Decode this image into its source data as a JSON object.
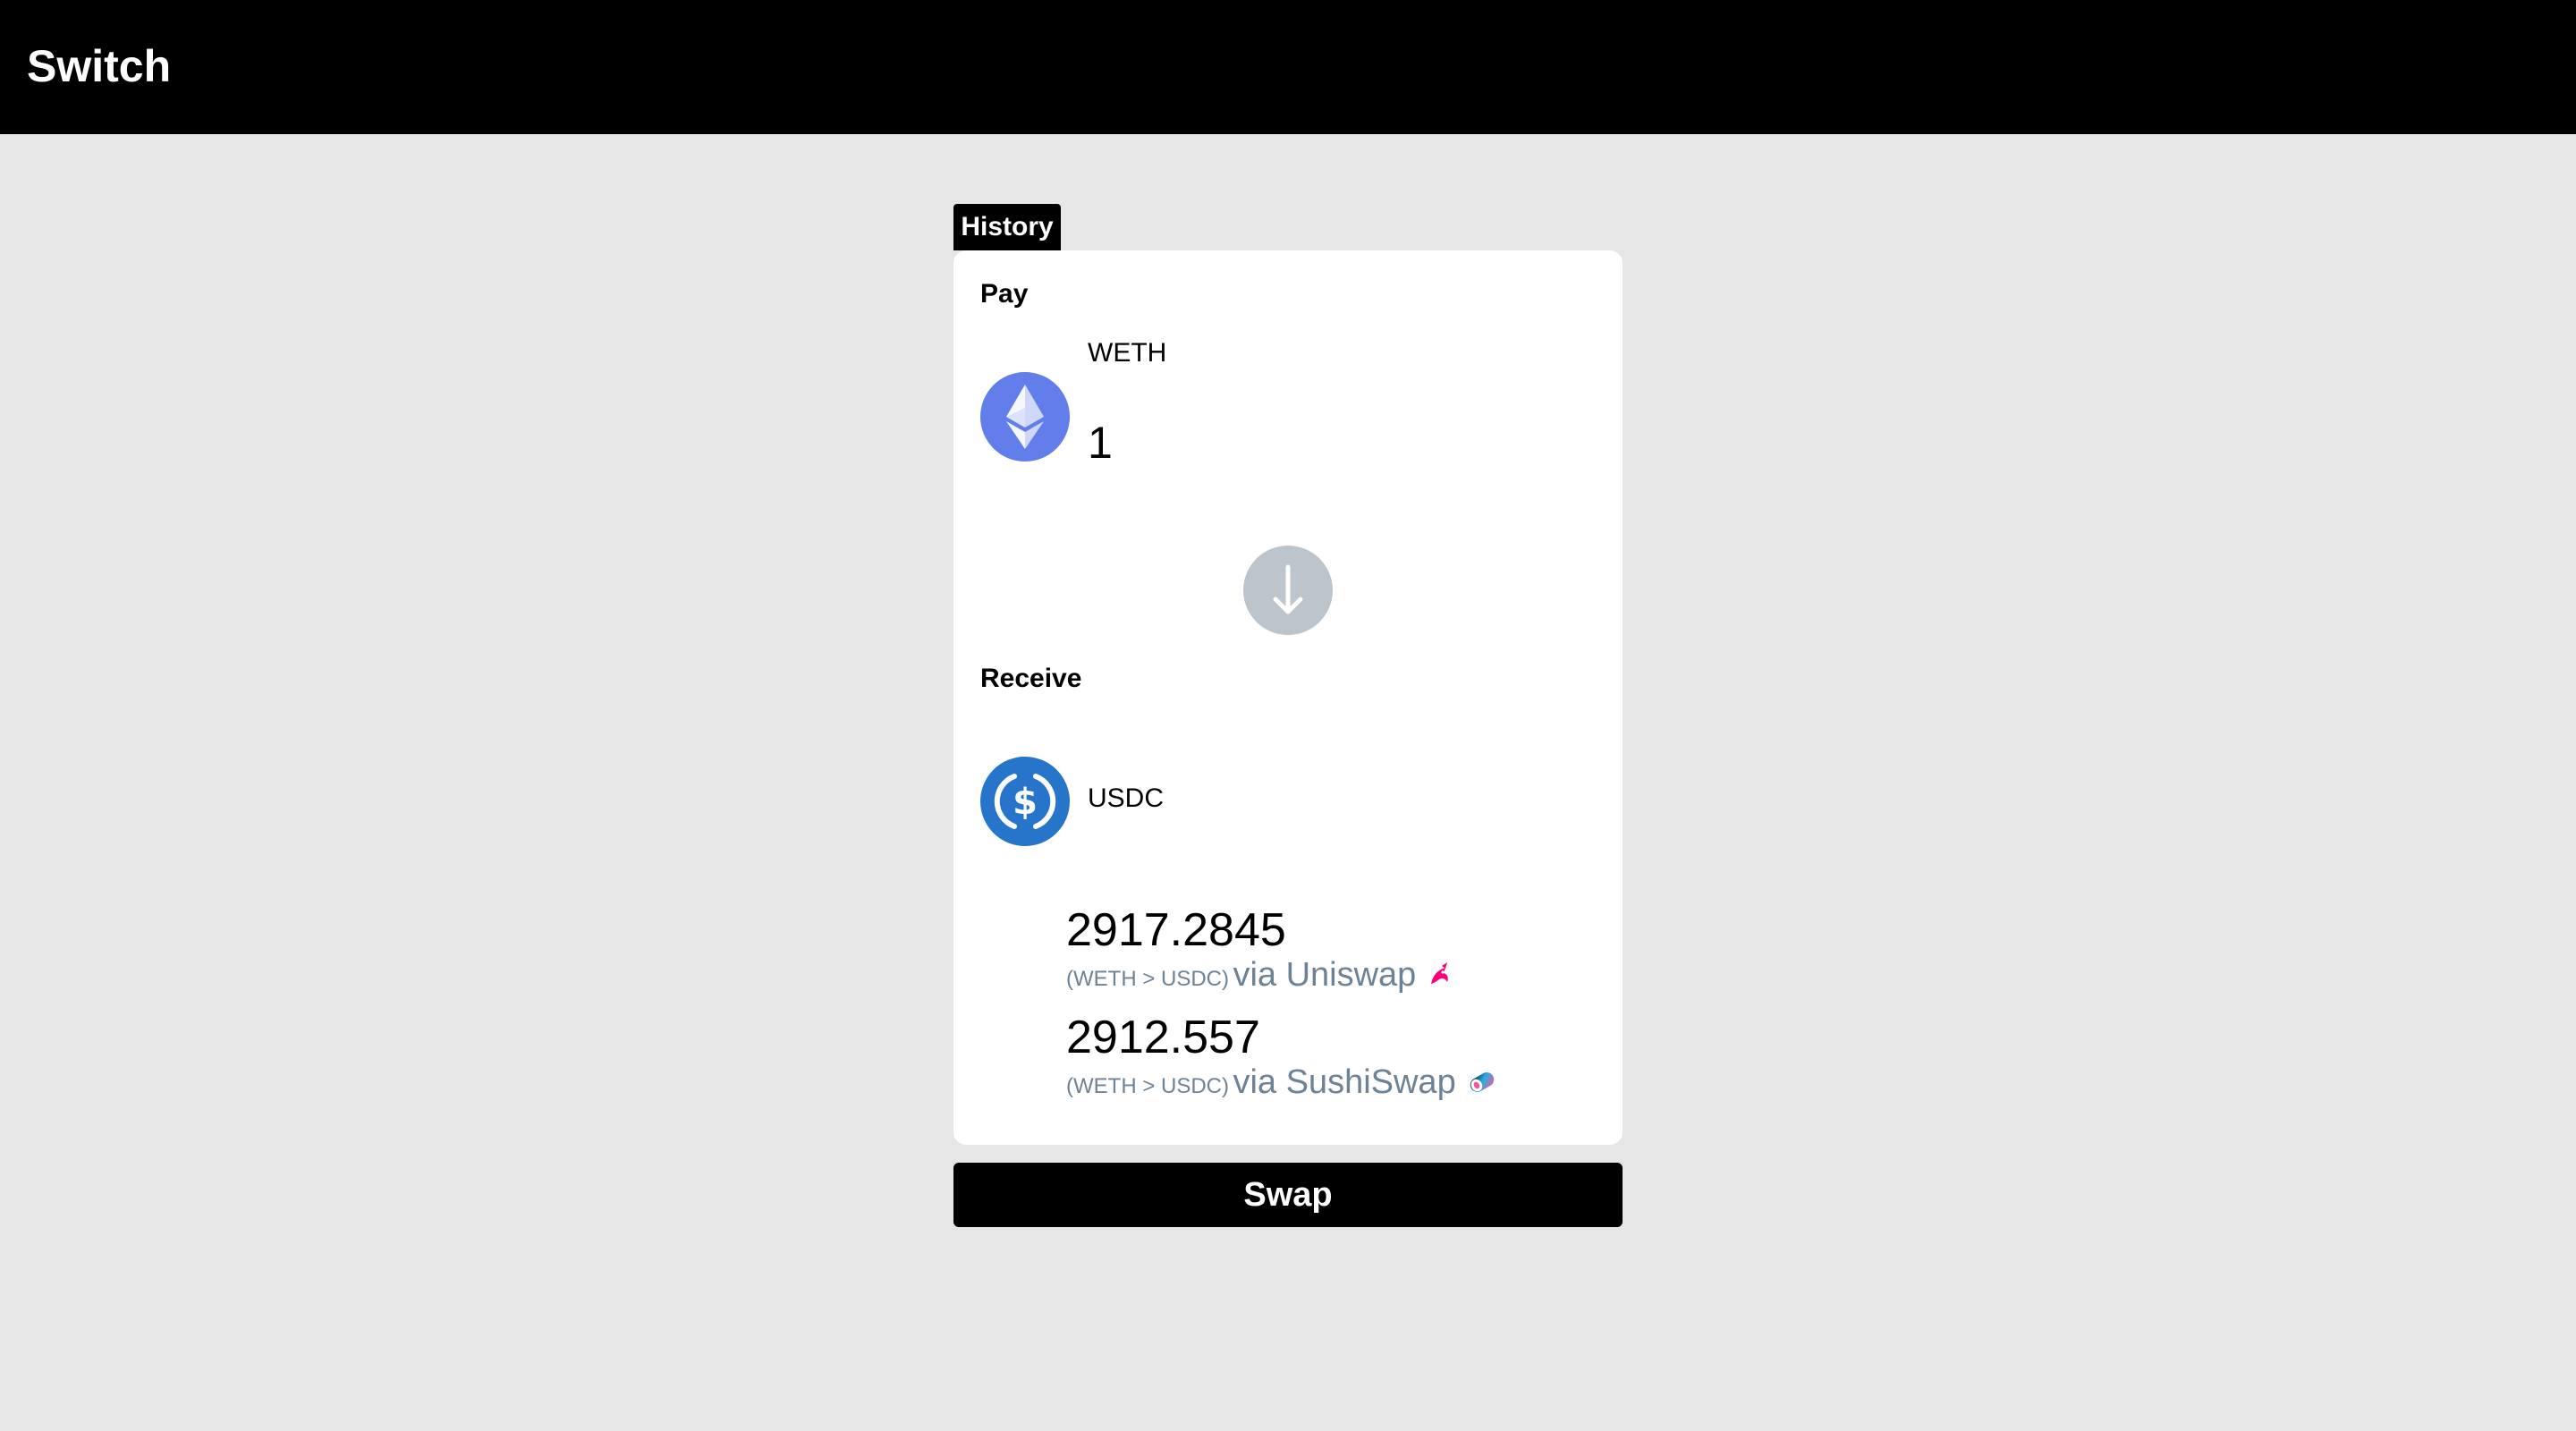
{
  "header": {
    "title": "Switch"
  },
  "history_tab": {
    "label": "History"
  },
  "pay": {
    "label": "Pay",
    "token": {
      "symbol": "WETH",
      "icon": "ethereum-icon",
      "color": "#627eea"
    },
    "amount": "1"
  },
  "direction": {
    "icon": "arrow-down-icon",
    "color": "#bcc4cc"
  },
  "receive": {
    "label": "Receive",
    "token": {
      "symbol": "USDC",
      "icon": "usdc-icon",
      "color": "#2775ca"
    },
    "quotes": [
      {
        "amount": "2917.2845",
        "route": "(WETH > USDC)",
        "via": "via Uniswap",
        "dex_icon": "uniswap-unicorn-icon"
      },
      {
        "amount": "2912.557",
        "route": "(WETH > USDC)",
        "via": "via SushiSwap",
        "dex_icon": "sushiswap-icon"
      }
    ]
  },
  "actions": {
    "swap_label": "Swap"
  },
  "colors": {
    "background": "#e6e6e6",
    "header": "#000000",
    "route_text": "#6e8296"
  }
}
